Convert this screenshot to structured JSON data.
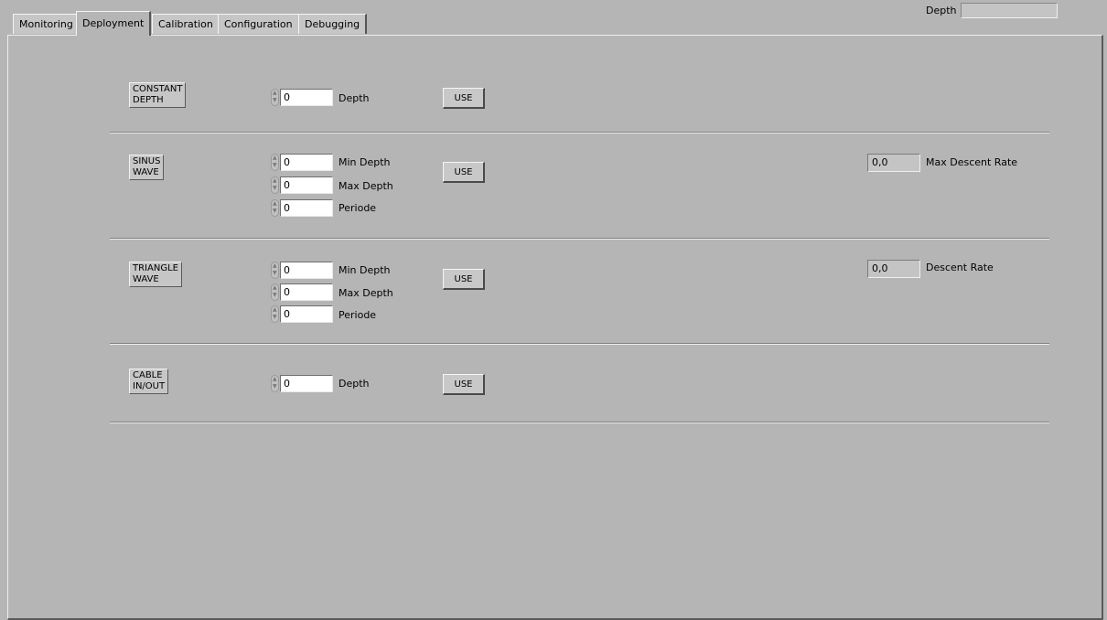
{
  "tabs": [
    {
      "label": "Monitoring"
    },
    {
      "label": "Deployment"
    },
    {
      "label": "Calibration"
    },
    {
      "label": "Configuration"
    },
    {
      "label": "Debugging"
    }
  ],
  "header": {
    "depth_label": "Depth",
    "depth_value": ""
  },
  "sections": {
    "constant": {
      "mode_line1": "CONSTANT",
      "mode_line2": "DEPTH",
      "depth_value": "0",
      "depth_label": "Depth",
      "use_label": "USE"
    },
    "sinus": {
      "mode_line1": "SINUS",
      "mode_line2": "WAVE",
      "min_value": "0",
      "min_label": "Min Depth",
      "max_value": "0",
      "max_label": "Max Depth",
      "period_value": "0",
      "period_label": "Periode",
      "use_label": "USE",
      "rate_value": "0,0",
      "rate_label": "Max Descent Rate"
    },
    "triangle": {
      "mode_line1": "TRIANGLE",
      "mode_line2": "WAVE",
      "min_value": "0",
      "min_label": "Min Depth",
      "max_value": "0",
      "max_label": "Max Depth",
      "period_value": "0",
      "period_label": "Periode",
      "use_label": "USE",
      "rate_value": "0,0",
      "rate_label": "Descent Rate"
    },
    "cable": {
      "mode_line1": "CABLE",
      "mode_line2": "IN/OUT",
      "depth_value": "0",
      "depth_label": "Depth",
      "use_label": "USE"
    }
  },
  "icons": {
    "spinner": "increment-decrement-arrows-icon"
  }
}
